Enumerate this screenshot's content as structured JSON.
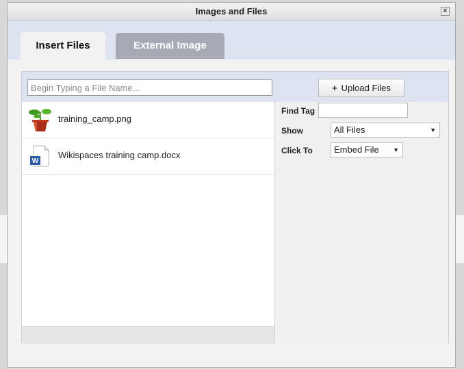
{
  "dialog": {
    "title": "Images and Files",
    "close_label": "×"
  },
  "tabs": [
    {
      "label": "Insert Files",
      "active": true
    },
    {
      "label": "External Image",
      "active": false
    }
  ],
  "search": {
    "placeholder": "Begin Typing a File Name...",
    "value": ""
  },
  "upload": {
    "label": "Upload Files",
    "icon": "plus-icon"
  },
  "files": [
    {
      "name": "training_camp.png",
      "icon": "plant-image-icon"
    },
    {
      "name": "Wikispaces training camp.docx",
      "icon": "word-document-icon"
    }
  ],
  "filters": {
    "find_tag": {
      "label": "Find Tag",
      "value": ""
    },
    "show": {
      "label": "Show",
      "value": "All Files"
    },
    "click_to": {
      "label": "Click To",
      "value": "Embed File"
    }
  },
  "colors": {
    "header_bg": "#dde3f1",
    "inactive_tab": "#a7a9b4"
  }
}
